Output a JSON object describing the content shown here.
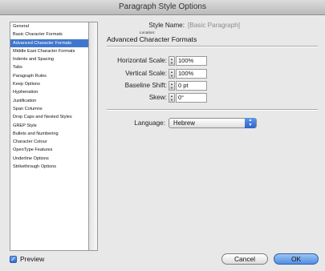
{
  "window": {
    "title": "Paragraph Style Options"
  },
  "sidebar": {
    "items": [
      {
        "label": "General",
        "selected": false
      },
      {
        "label": "Basic Character Formats",
        "selected": false
      },
      {
        "label": "Advanced Character Formats",
        "selected": true
      },
      {
        "label": "Middle East Character Formats",
        "selected": false
      },
      {
        "label": "Indents and Spacing",
        "selected": false
      },
      {
        "label": "Tabs",
        "selected": false
      },
      {
        "label": "Paragraph Rules",
        "selected": false
      },
      {
        "label": "Keep Options",
        "selected": false
      },
      {
        "label": "Hyphenation",
        "selected": false
      },
      {
        "label": "Justification",
        "selected": false
      },
      {
        "label": "Span Columns",
        "selected": false
      },
      {
        "label": "Drop Caps and Nested Styles",
        "selected": false
      },
      {
        "label": "GREP Style",
        "selected": false
      },
      {
        "label": "Bullets and Numbering",
        "selected": false
      },
      {
        "label": "Character Colour",
        "selected": false
      },
      {
        "label": "OpenType Features",
        "selected": false
      },
      {
        "label": "Underline Options",
        "selected": false
      },
      {
        "label": "Strikethrough Options",
        "selected": false
      }
    ]
  },
  "style": {
    "name_label": "Style Name:",
    "name_value": "[Basic Paragraph]",
    "location_label": "Location:"
  },
  "section": {
    "title": "Advanced Character Formats"
  },
  "fields": {
    "horizontal_scale": {
      "label": "Horizontal Scale:",
      "value": "100%"
    },
    "vertical_scale": {
      "label": "Vertical Scale:",
      "value": "100%"
    },
    "baseline_shift": {
      "label": "Baseline Shift:",
      "value": "0 pt"
    },
    "skew": {
      "label": "Skew:",
      "value": "0°"
    }
  },
  "language": {
    "label": "Language:",
    "value": "Hebrew"
  },
  "footer": {
    "preview_label": "Preview",
    "preview_checked": true,
    "cancel_label": "Cancel",
    "ok_label": "OK"
  },
  "colors": {
    "selection": "#3f77cc",
    "accent": "#4f8fe3"
  }
}
